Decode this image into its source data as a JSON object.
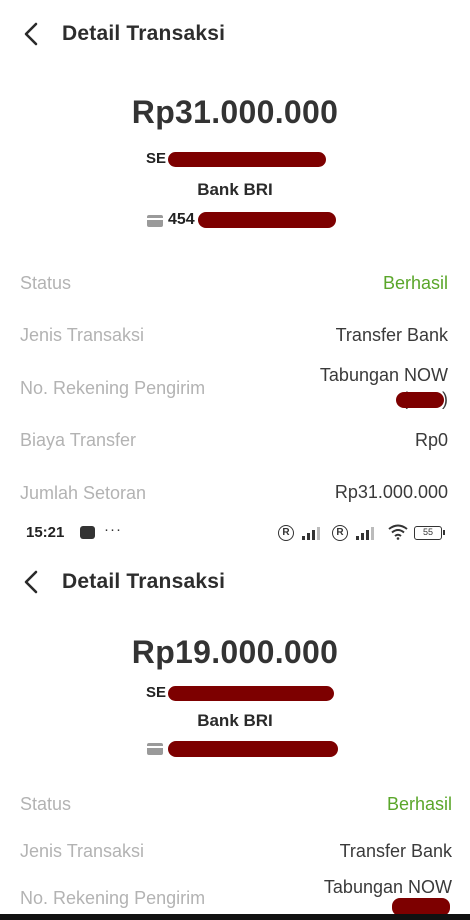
{
  "transactions": [
    {
      "header": {
        "title": "Detail Transaksi"
      },
      "amount": "Rp31.000.000",
      "recipient_prefix": "SE",
      "bank": "Bank BRI",
      "account_prefix": "454",
      "rows": {
        "status": {
          "label": "Status",
          "value": "Berhasil"
        },
        "type": {
          "label": "Jenis Transaksi",
          "value": "Transfer Bank"
        },
        "sender": {
          "label": "No. Rekening Pengirim",
          "value": "Tabungan NOW",
          "open": "(",
          "close": ")"
        },
        "fee": {
          "label": "Biaya Transfer",
          "value": "Rp0"
        },
        "total": {
          "label": "Jumlah Setoran",
          "value": "Rp31.000.000"
        }
      }
    },
    {
      "header": {
        "title": "Detail Transaksi"
      },
      "amount": "Rp19.000.000",
      "recipient_prefix": "SE",
      "bank": "Bank BRI",
      "rows": {
        "status": {
          "label": "Status",
          "value": "Berhasil"
        },
        "type": {
          "label": "Jenis Transaksi",
          "value": "Transfer Bank"
        },
        "sender": {
          "label": "No. Rekening Pengirim",
          "value": "Tabungan NOW"
        }
      }
    }
  ],
  "statusbar": {
    "time": "15:21",
    "dots": "···",
    "roaming_1": "R",
    "roaming_2": "R",
    "battery": "55"
  },
  "colors": {
    "success": "#5aa62a",
    "redaction": "#7d0000"
  },
  "icons": [
    "back-arrow-icon",
    "card-icon",
    "wifi-icon",
    "signal-icon",
    "battery-icon"
  ]
}
